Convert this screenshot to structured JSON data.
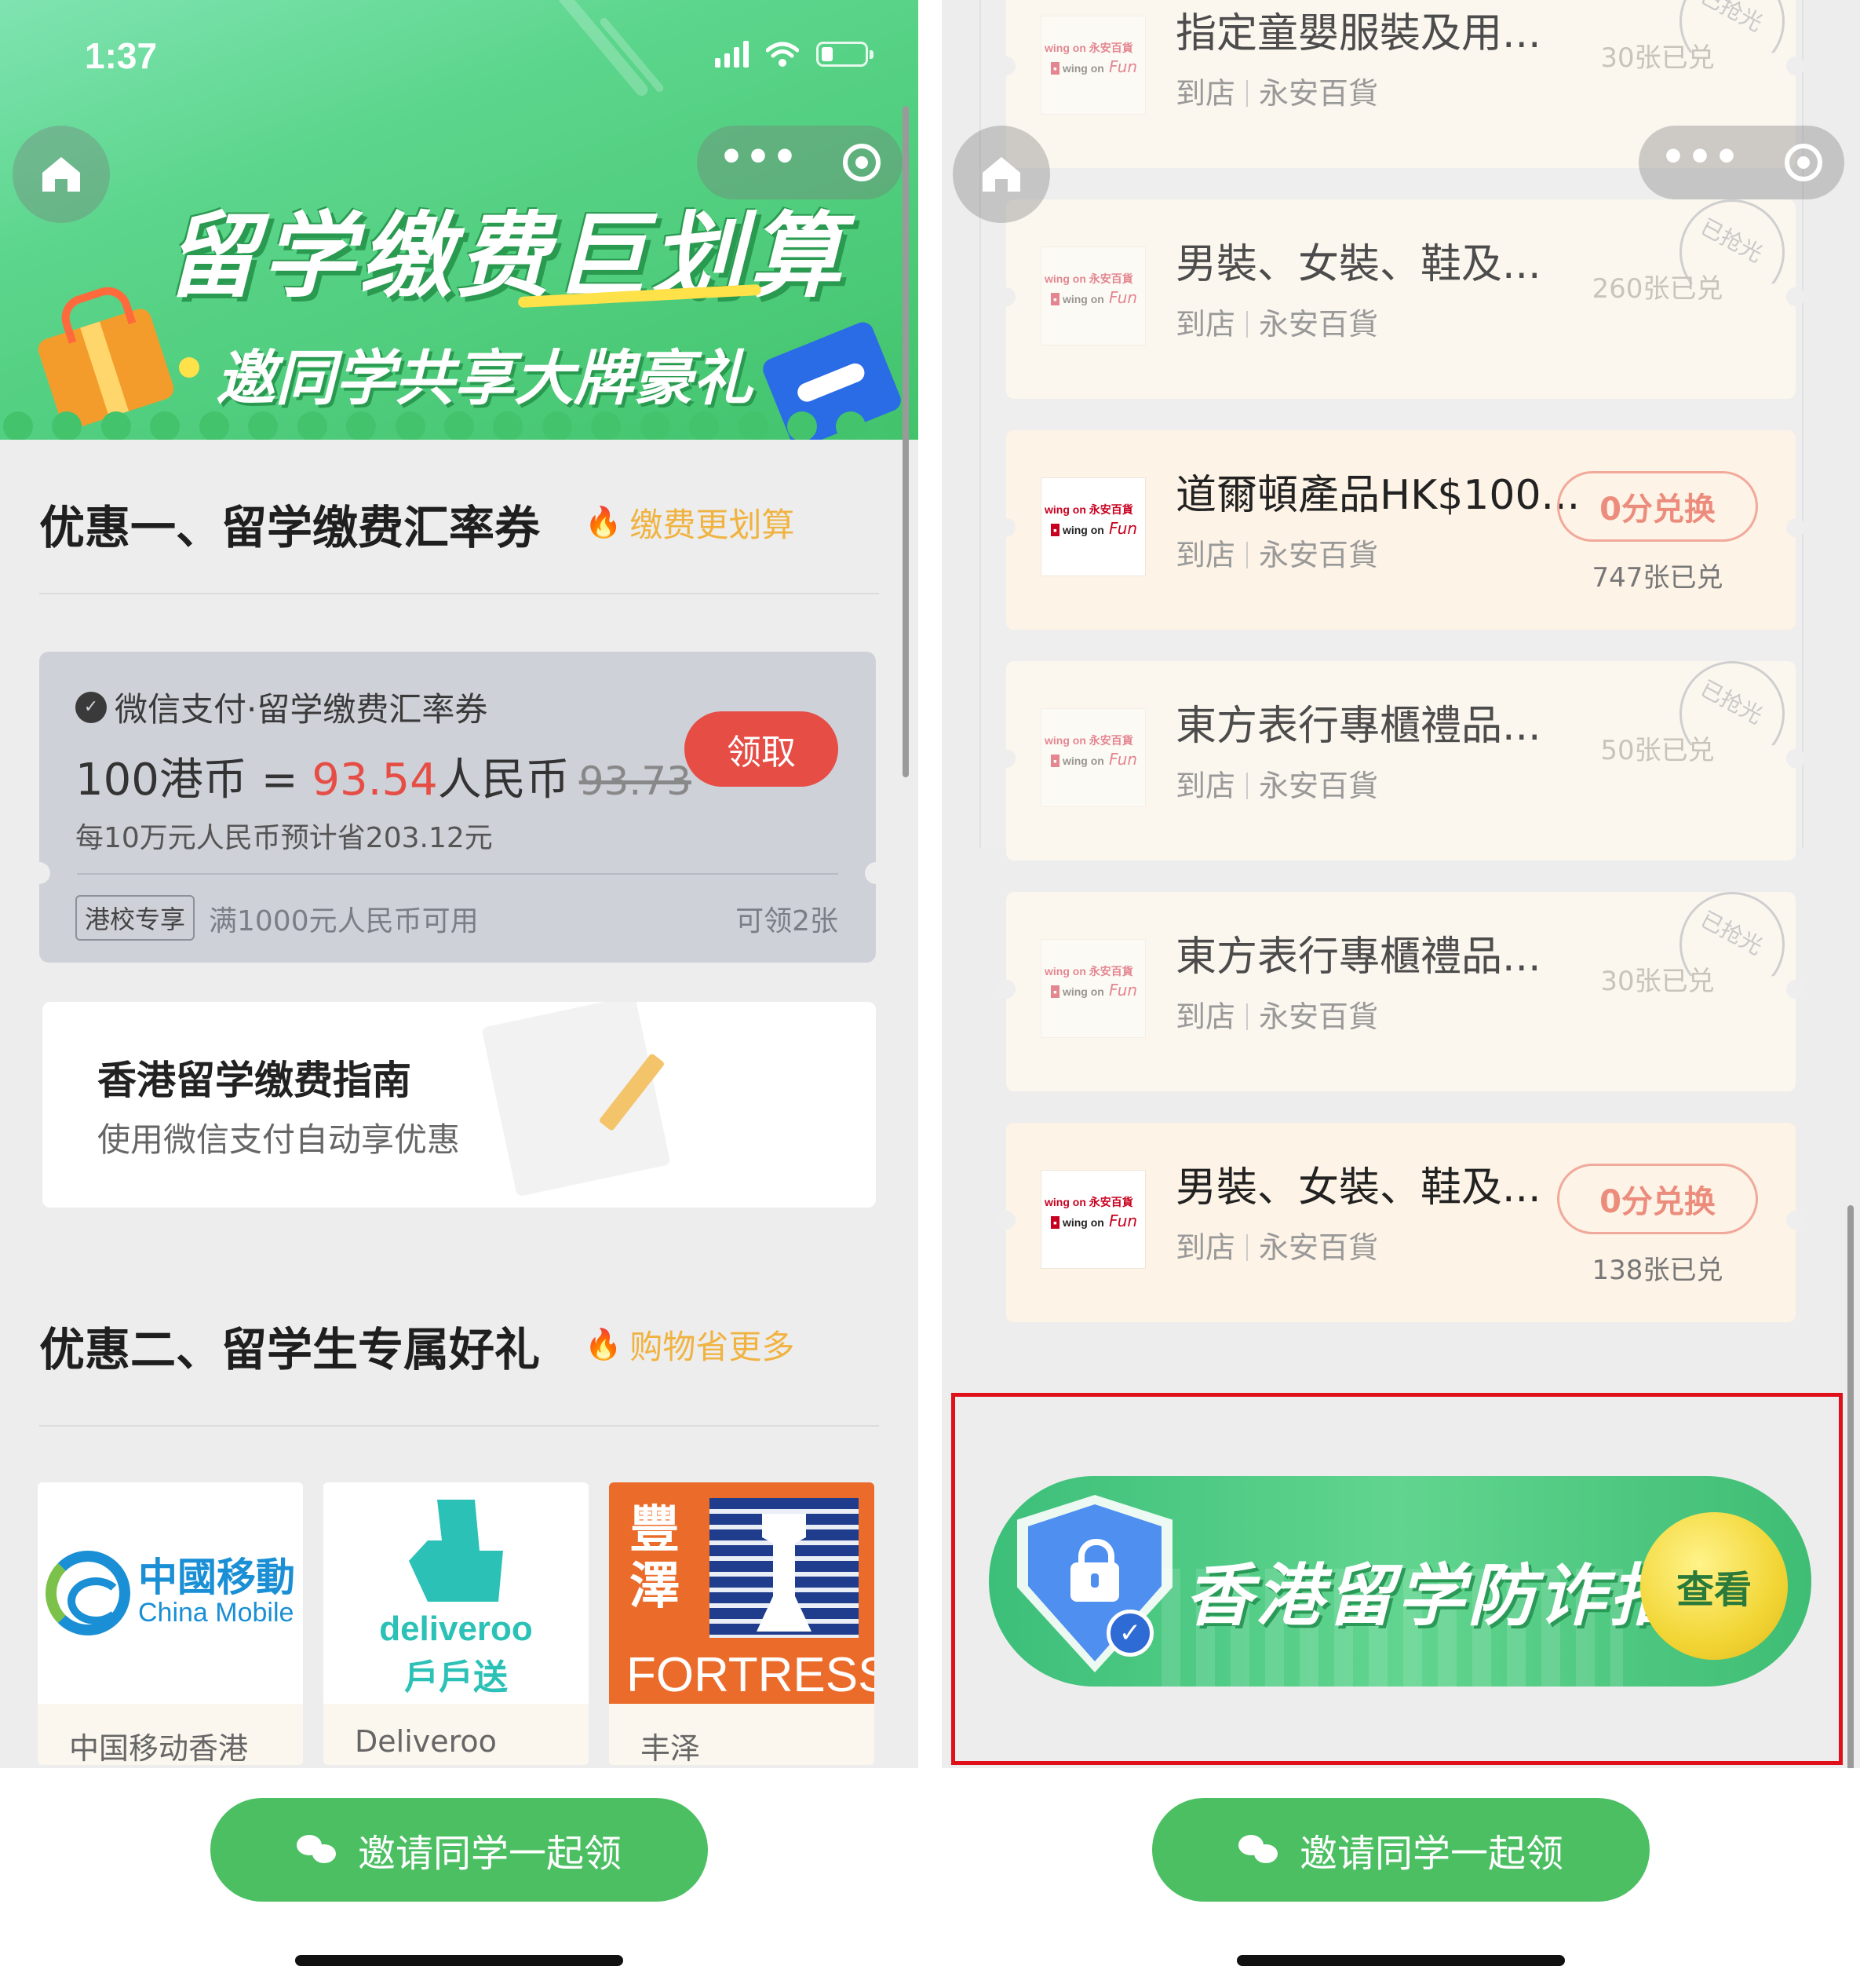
{
  "left": {
    "status": {
      "time": "1:37"
    },
    "banner": {
      "title": "留学缴费巨划算",
      "subtitle": "邀同学共享大牌豪礼"
    },
    "section1": {
      "title": "优惠一、留学缴费汇率券",
      "tag": "缴费更划算"
    },
    "coupon": {
      "title": "微信支付·留学缴费汇率券",
      "rate_prefix": "100港币 = ",
      "rate_value": "93.54",
      "rate_unit": "人民币",
      "rate_old": "93.73",
      "savings": "每10万元人民币预计省203.12元",
      "claim_label": "领取",
      "badge": "港校专享",
      "condition": "满1000元人民币可用",
      "limit": "可领2张",
      "accent_color": "#e54d45"
    },
    "guide": {
      "title": "香港留学缴费指南",
      "subtitle": "使用微信支付自动享优惠"
    },
    "section2": {
      "title": "优惠二、留学生专属好礼",
      "tag": "购物省更多"
    },
    "brands": [
      {
        "name": "中国移动香港",
        "logo_text_cn": "中國移動",
        "logo_text_en": "China Mobile"
      },
      {
        "name": "Deliveroo",
        "logo_text_en": "deliveroo",
        "logo_text_cn": "戶戶送"
      },
      {
        "name": "丰泽",
        "logo_text_cn_1": "豐",
        "logo_text_cn_2": "澤",
        "logo_text_en": "FORTRESS"
      }
    ],
    "invite_label": "邀请同学一起领"
  },
  "right": {
    "products": [
      {
        "name": "指定童嬰服裝及用...",
        "type": "到店",
        "store": "永安百貨",
        "count": "30张已兑",
        "sold_out": true,
        "stamp": "已抢光"
      },
      {
        "name": "男裝、女裝、鞋及...",
        "type": "到店",
        "store": "永安百貨",
        "count": "260张已兑",
        "sold_out": true,
        "stamp": "已抢光"
      },
      {
        "name": "道爾頓產品HK$100...",
        "type": "到店",
        "store": "永安百貨",
        "count": "747张已兑",
        "sold_out": false,
        "button": "0分兑换"
      },
      {
        "name": "東方表行專櫃禮品...",
        "type": "到店",
        "store": "永安百貨",
        "count": "50张已兑",
        "sold_out": true,
        "stamp": "已抢光"
      },
      {
        "name": "東方表行專櫃禮品...",
        "type": "到店",
        "store": "永安百貨",
        "count": "30张已兑",
        "sold_out": true,
        "stamp": "已抢光"
      },
      {
        "name": "男裝、女裝、鞋及...",
        "type": "到店",
        "store": "永安百貨",
        "count": "138张已兑",
        "sold_out": false,
        "button": "0分兑换"
      }
    ],
    "store_logo": {
      "line1": "wing on 永安百貨",
      "badge": "",
      "line2": "wing on",
      "script": "Fun"
    },
    "fraud_banner": {
      "title": "香港留学防诈指南",
      "button": "查看"
    },
    "invite_label": "邀请同学一起领",
    "highlight_color": "#e0101b"
  },
  "icons": [
    "home-icon",
    "more-icon",
    "target-icon",
    "wechat-icon",
    "flame-icon",
    "shield-icon",
    "lock-icon",
    "check-icon"
  ]
}
